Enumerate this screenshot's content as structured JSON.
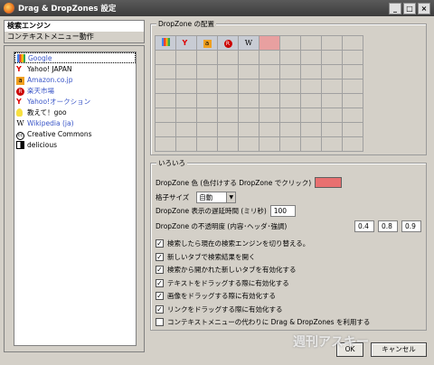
{
  "window": {
    "title": "Drag & DropZones 設定",
    "btn_min": "_",
    "btn_max": "□",
    "btn_close": "×"
  },
  "tabs": {
    "search_engines": "検索エンジン",
    "context_menu": "コンテキストメニュー動作"
  },
  "engines": [
    {
      "label": "Google",
      "icon": "google-icon",
      "color": "#3a56c8"
    },
    {
      "label": "Yahoo! JAPAN",
      "icon": "yahoo-icon",
      "color": "#000000"
    },
    {
      "label": "Amazon.co.jp",
      "icon": "amazon-icon",
      "color": "#3a56c8"
    },
    {
      "label": "楽天市場",
      "icon": "rakuten-icon",
      "color": "#3a56c8"
    },
    {
      "label": "Yahoo!オークション",
      "icon": "yahoo-auction-icon",
      "color": "#3a56c8"
    },
    {
      "label": "教えて！goo",
      "icon": "oshiete-goo-icon",
      "color": "#000000"
    },
    {
      "label": "Wikipedia (ja)",
      "icon": "wikipedia-icon",
      "color": "#3a56c8"
    },
    {
      "label": "Creative Commons",
      "icon": "creative-commons-icon",
      "color": "#000000"
    },
    {
      "label": "delicious",
      "icon": "delicious-icon",
      "color": "#000000"
    }
  ],
  "placement": {
    "label": "DropZone の配置",
    "columns": 10,
    "rows": 8,
    "filled": [
      "google-icon",
      "yahoo-icon",
      "amazon-icon",
      "rakuten-icon",
      "wikipedia-icon"
    ]
  },
  "misc": {
    "label": "いろいろ",
    "color_label": "DropZone 色 (色付けする DropZone でクリック)",
    "color_value": "#e87070",
    "grid_size_label": "格子サイズ",
    "grid_size_value": "自動",
    "delay_label": "DropZone 表示の遅延時間 (ミリ秒)",
    "delay_value": "100",
    "opacity_label": "DropZone の不透明度 (内容･ヘッダ･強調)",
    "opacity_values": [
      "0.4",
      "0.8",
      "0.9"
    ]
  },
  "options": [
    {
      "label": "検索したら現在の検索エンジンを切り替える。",
      "checked": true
    },
    {
      "label": "新しいタブで検索結果を開く",
      "checked": true
    },
    {
      "label": "検索から開かれた新しいタブを有効化する",
      "checked": true
    },
    {
      "label": "テキストをドラッグする際に有効化する",
      "checked": true
    },
    {
      "label": "画像をドラッグする際に有効化する",
      "checked": true
    },
    {
      "label": "リンクをドラッグする際に有効化する",
      "checked": true
    },
    {
      "label": "コンテキストメニューの代わりに Drag & DropZones を利用する",
      "checked": false
    }
  ],
  "buttons": {
    "ok": "OK",
    "cancel": "キャンセル"
  },
  "watermark": "週刊アスキー"
}
